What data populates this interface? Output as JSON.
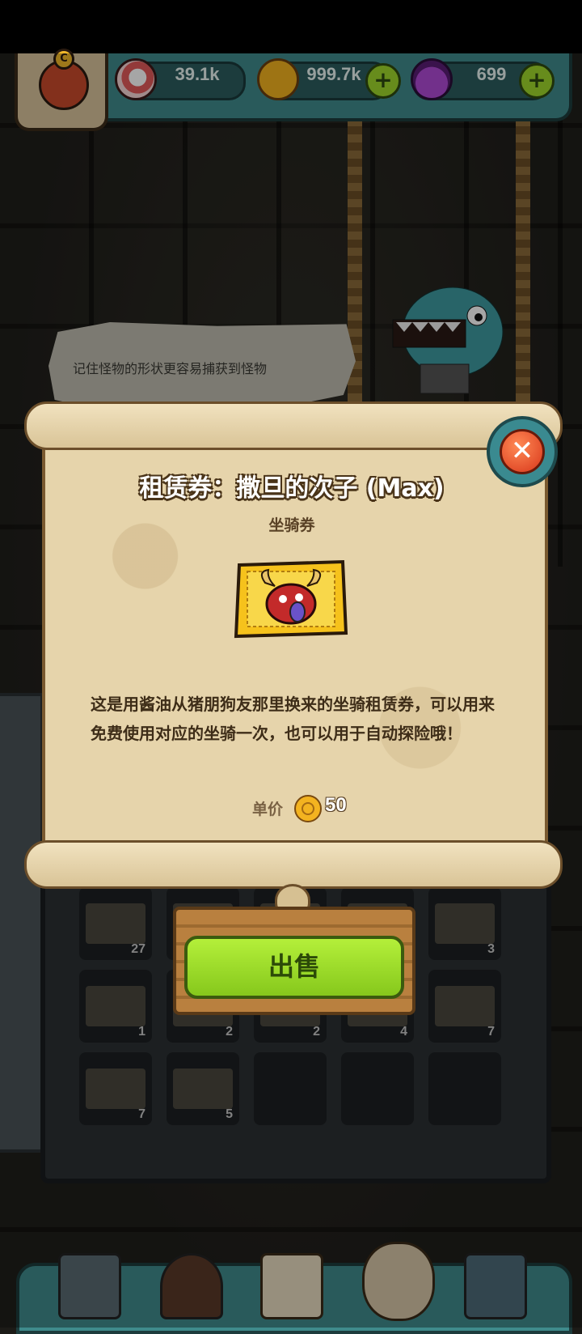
{
  "topbar": {
    "eyeballs": "39.1k",
    "coins": "999.7k",
    "potions": "699",
    "avatar_badge": "C"
  },
  "background": {
    "hint": "记住怪物的形状更容易捕获到怪物"
  },
  "inventory": {
    "counts": [
      "27",
      "",
      "",
      "",
      "3",
      "1",
      "2",
      "2",
      "4",
      "7",
      "7",
      "5",
      "",
      "",
      ""
    ]
  },
  "dialog": {
    "title": "租赁券：撒旦的次子 (Max)",
    "subtitle": "坐骑券",
    "description": "这是用酱油从猪朋狗友那里换来的坐骑租赁券，可以用来免费使用对应的坐骑一次，也可以用于自动探险哦！",
    "price_label": "单价",
    "price_value": "50",
    "sell_label": "出售",
    "close_icon": "close-icon"
  },
  "colors": {
    "accent_teal": "#3f8b8c",
    "sell_green": "#9fd82b",
    "parchment": "#e6d4ab",
    "close_red": "#d8361a"
  }
}
